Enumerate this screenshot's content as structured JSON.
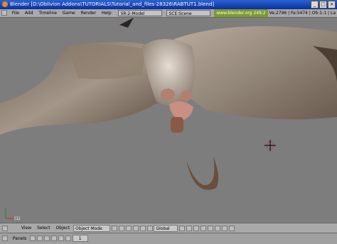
{
  "window": {
    "title": "Blender [D:\\Oblivion Addons\\TUTORIALS\\Tutorial_and_files-28326\\RABTUT1.blend]"
  },
  "menubar": {
    "items": [
      "File",
      "Add",
      "Timeline",
      "Game",
      "Render",
      "Help"
    ],
    "screen": "SR:2-Model",
    "scene": "SCE:Scene",
    "link": "www.blender.org 249.2",
    "stats": "Ve:2796 | Fa:5474 | Ob:1-1 | La"
  },
  "viewport": {
    "frame_label": "(1)"
  },
  "header3d": {
    "menus": [
      "View",
      "Select",
      "Object"
    ],
    "mode": "Object Mode",
    "pivot": "Global"
  },
  "panelsbar": {
    "label": "Panels",
    "page": "1"
  },
  "colors": {
    "titlebar": "#0a2fa0",
    "header": "#a9a9a9",
    "viewport_bg": "#7d7d7d",
    "link_bg": "#7c9b2e"
  }
}
